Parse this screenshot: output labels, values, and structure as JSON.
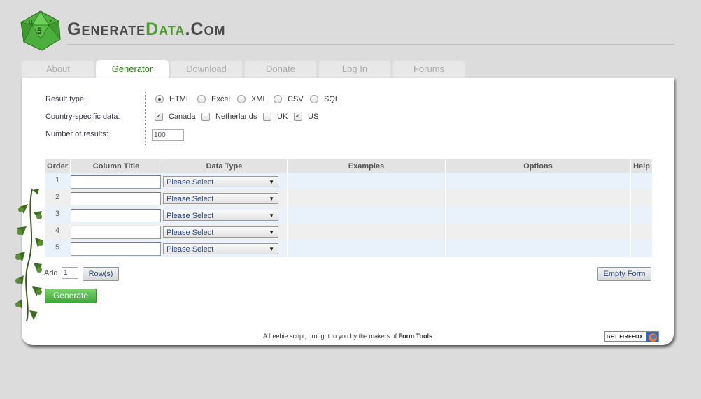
{
  "header": {
    "title_part1": "Generate",
    "title_part2": "Data",
    "title_part3": ".Com"
  },
  "tabs": [
    {
      "label": "About"
    },
    {
      "label": "Generator"
    },
    {
      "label": "Download"
    },
    {
      "label": "Donate"
    },
    {
      "label": "Log In"
    },
    {
      "label": "Forums"
    }
  ],
  "active_tab": "Generator",
  "form": {
    "result_type_label": "Result type:",
    "result_types": [
      "HTML",
      "Excel",
      "XML",
      "CSV",
      "SQL"
    ],
    "result_type_selected": "HTML",
    "country_label": "Country-specific data:",
    "countries": [
      {
        "label": "Canada",
        "checked": true
      },
      {
        "label": "Netherlands",
        "checked": false
      },
      {
        "label": "UK",
        "checked": false
      },
      {
        "label": "US",
        "checked": true
      }
    ],
    "num_results_label": "Number of results:",
    "num_results_value": "100"
  },
  "table": {
    "headers": [
      "Order",
      "Column Title",
      "Data Type",
      "Examples",
      "Options",
      "Help"
    ],
    "rows": [
      {
        "order": "1",
        "data_type": "Please Select"
      },
      {
        "order": "2",
        "data_type": "Please Select"
      },
      {
        "order": "3",
        "data_type": "Please Select"
      },
      {
        "order": "4",
        "data_type": "Please Select"
      },
      {
        "order": "5",
        "data_type": "Please Select"
      }
    ]
  },
  "controls": {
    "add_label": "Add",
    "add_value": "1",
    "rows_button": "Row(s)",
    "empty_button": "Empty Form",
    "generate_button": "Generate"
  },
  "footer": {
    "text": "A freebie script, brought to you by the makers of",
    "link": "Form Tools",
    "badge": "GET FIREFOX"
  },
  "colors": {
    "accent_green": "#4e9c32",
    "row_blue": "#e9f1fb",
    "row_gray": "#efefef"
  }
}
